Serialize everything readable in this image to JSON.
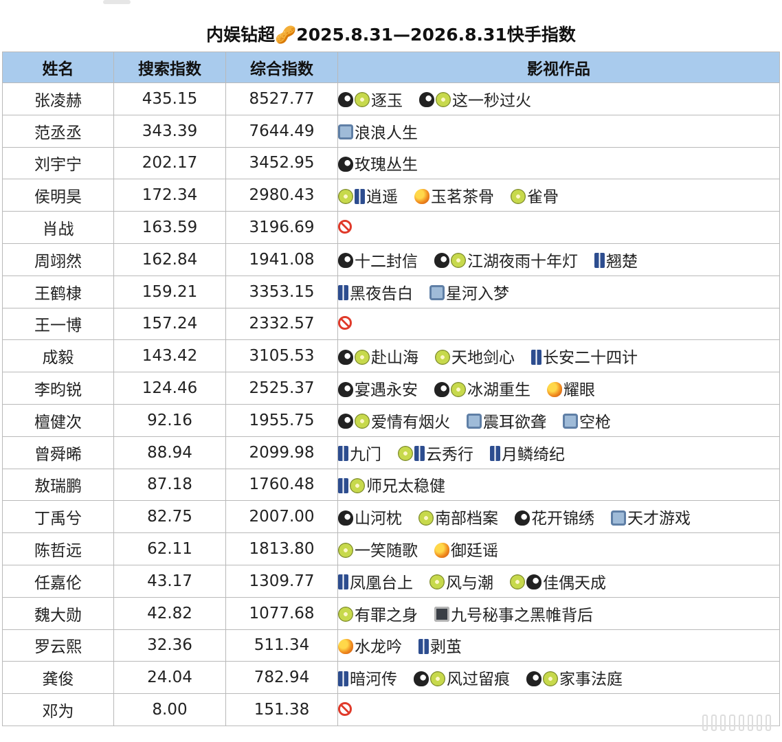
{
  "title": "内娱钻超🥜2025.8.31—2026.8.31快手指数",
  "headers": [
    "姓名",
    "搜索指数",
    "综合指数",
    "影视作品"
  ],
  "rows": [
    {
      "name": "张凌赫",
      "search": "435.15",
      "composite": "8527.77",
      "works": [
        {
          "icons": [
            "penguin",
            "kiwi"
          ],
          "text": "逐玉"
        },
        {
          "icons": [
            "penguin",
            "kiwi"
          ],
          "text": "这一秒过火"
        }
      ]
    },
    {
      "name": "范丞丞",
      "search": "343.39",
      "composite": "7644.49",
      "works": [
        {
          "icons": [
            "tv"
          ],
          "text": "浪浪人生"
        }
      ]
    },
    {
      "name": "刘宇宁",
      "search": "202.17",
      "composite": "3452.95",
      "works": [
        {
          "icons": [
            "penguin"
          ],
          "text": "玫瑰丛生"
        }
      ]
    },
    {
      "name": "侯明昊",
      "search": "172.34",
      "composite": "2980.43",
      "works": [
        {
          "icons": [
            "kiwi",
            "jeans"
          ],
          "text": "逍遥"
        },
        {
          "icons": [
            "mango"
          ],
          "text": "玉茗茶骨"
        },
        {
          "icons": [
            "kiwi"
          ],
          "text": "雀骨"
        }
      ]
    },
    {
      "name": "肖战",
      "search": "163.59",
      "composite": "3196.69",
      "works": [
        {
          "icons": [
            "none"
          ],
          "text": ""
        }
      ]
    },
    {
      "name": "周翊然",
      "search": "162.84",
      "composite": "1941.08",
      "works": [
        {
          "icons": [
            "penguin"
          ],
          "text": "十二封信"
        },
        {
          "icons": [
            "penguin",
            "kiwi"
          ],
          "text": "江湖夜雨十年灯"
        },
        {
          "icons": [
            "jeans"
          ],
          "text": "翘楚"
        }
      ]
    },
    {
      "name": "王鹤棣",
      "search": "159.21",
      "composite": "3353.15",
      "works": [
        {
          "icons": [
            "jeans"
          ],
          "text": "黑夜告白"
        },
        {
          "icons": [
            "tv"
          ],
          "text": "星河入梦"
        }
      ]
    },
    {
      "name": "王一博",
      "search": "157.24",
      "composite": "2332.57",
      "works": [
        {
          "icons": [
            "none"
          ],
          "text": ""
        }
      ]
    },
    {
      "name": "成毅",
      "search": "143.42",
      "composite": "3105.53",
      "works": [
        {
          "icons": [
            "penguin",
            "kiwi"
          ],
          "text": "赴山海"
        },
        {
          "icons": [
            "kiwi"
          ],
          "text": "天地剑心"
        },
        {
          "icons": [
            "jeans"
          ],
          "text": "长安二十四计"
        }
      ]
    },
    {
      "name": "李昀锐",
      "search": "124.46",
      "composite": "2525.37",
      "works": [
        {
          "icons": [
            "penguin"
          ],
          "text": "宴遇永安"
        },
        {
          "icons": [
            "penguin",
            "kiwi"
          ],
          "text": "冰湖重生"
        },
        {
          "icons": [
            "mango"
          ],
          "text": "耀眼"
        }
      ]
    },
    {
      "name": "檀健次",
      "search": "92.16",
      "composite": "1955.75",
      "works": [
        {
          "icons": [
            "penguin",
            "kiwi"
          ],
          "text": "爱情有烟火"
        },
        {
          "icons": [
            "tv"
          ],
          "text": "震耳欲聋"
        },
        {
          "icons": [
            "tv"
          ],
          "text": "空枪"
        }
      ]
    },
    {
      "name": "曾舜晞",
      "search": "88.94",
      "composite": "2099.98",
      "works": [
        {
          "icons": [
            "jeans"
          ],
          "text": "九门"
        },
        {
          "icons": [
            "kiwi",
            "jeans"
          ],
          "text": "云秀行"
        },
        {
          "icons": [
            "jeans"
          ],
          "text": "月鳞绮纪"
        }
      ]
    },
    {
      "name": "敖瑞鹏",
      "search": "87.18",
      "composite": "1760.48",
      "works": [
        {
          "icons": [
            "jeans",
            "kiwi"
          ],
          "text": "师兄太稳健"
        }
      ]
    },
    {
      "name": "丁禹兮",
      "search": "82.75",
      "composite": "2007.00",
      "works": [
        {
          "icons": [
            "penguin"
          ],
          "text": "山河枕"
        },
        {
          "icons": [
            "kiwi"
          ],
          "text": "南部档案"
        },
        {
          "icons": [
            "penguin"
          ],
          "text": "花开锦绣"
        },
        {
          "icons": [
            "tv"
          ],
          "text": "天才游戏"
        }
      ]
    },
    {
      "name": "陈哲远",
      "search": "62.11",
      "composite": "1813.80",
      "works": [
        {
          "icons": [
            "kiwi"
          ],
          "text": "一笑随歌"
        },
        {
          "icons": [
            "mango"
          ],
          "text": "御廷谣"
        }
      ]
    },
    {
      "name": "任嘉伦",
      "search": "43.17",
      "composite": "1309.77",
      "works": [
        {
          "icons": [
            "jeans"
          ],
          "text": "凤凰台上"
        },
        {
          "icons": [
            "kiwi"
          ],
          "text": "风与潮"
        },
        {
          "icons": [
            "kiwi",
            "penguin"
          ],
          "text": "佳偶天成"
        }
      ]
    },
    {
      "name": "魏大勋",
      "search": "42.82",
      "composite": "1077.68",
      "works": [
        {
          "icons": [
            "kiwi"
          ],
          "text": "有罪之身"
        },
        {
          "icons": [
            "monitor"
          ],
          "text": "九号秘事之黑帷背后"
        }
      ]
    },
    {
      "name": "罗云熙",
      "search": "32.36",
      "composite": "511.34",
      "works": [
        {
          "icons": [
            "mango"
          ],
          "text": "水龙吟"
        },
        {
          "icons": [
            "jeans"
          ],
          "text": "剥茧"
        }
      ]
    },
    {
      "name": "龚俊",
      "search": "24.04",
      "composite": "782.94",
      "works": [
        {
          "icons": [
            "jeans"
          ],
          "text": "暗河传"
        },
        {
          "icons": [
            "penguin",
            "kiwi"
          ],
          "text": "风过留痕"
        },
        {
          "icons": [
            "penguin",
            "kiwi"
          ],
          "text": "家事法庭"
        }
      ]
    },
    {
      "name": "邓为",
      "search": "8.00",
      "composite": "151.38",
      "works": [
        {
          "icons": [
            "none"
          ],
          "text": ""
        }
      ]
    }
  ],
  "icon_legend": {
    "penguin": "penguin-icon",
    "kiwi": "kiwi-icon",
    "jeans": "jeans-icon",
    "mango": "mango-icon",
    "tv": "tv-icon",
    "monitor": "monitor-icon",
    "none": "prohibited-icon"
  },
  "colors": {
    "header_bg": "#a9cbed",
    "grid_line": "#b9b9b9"
  }
}
